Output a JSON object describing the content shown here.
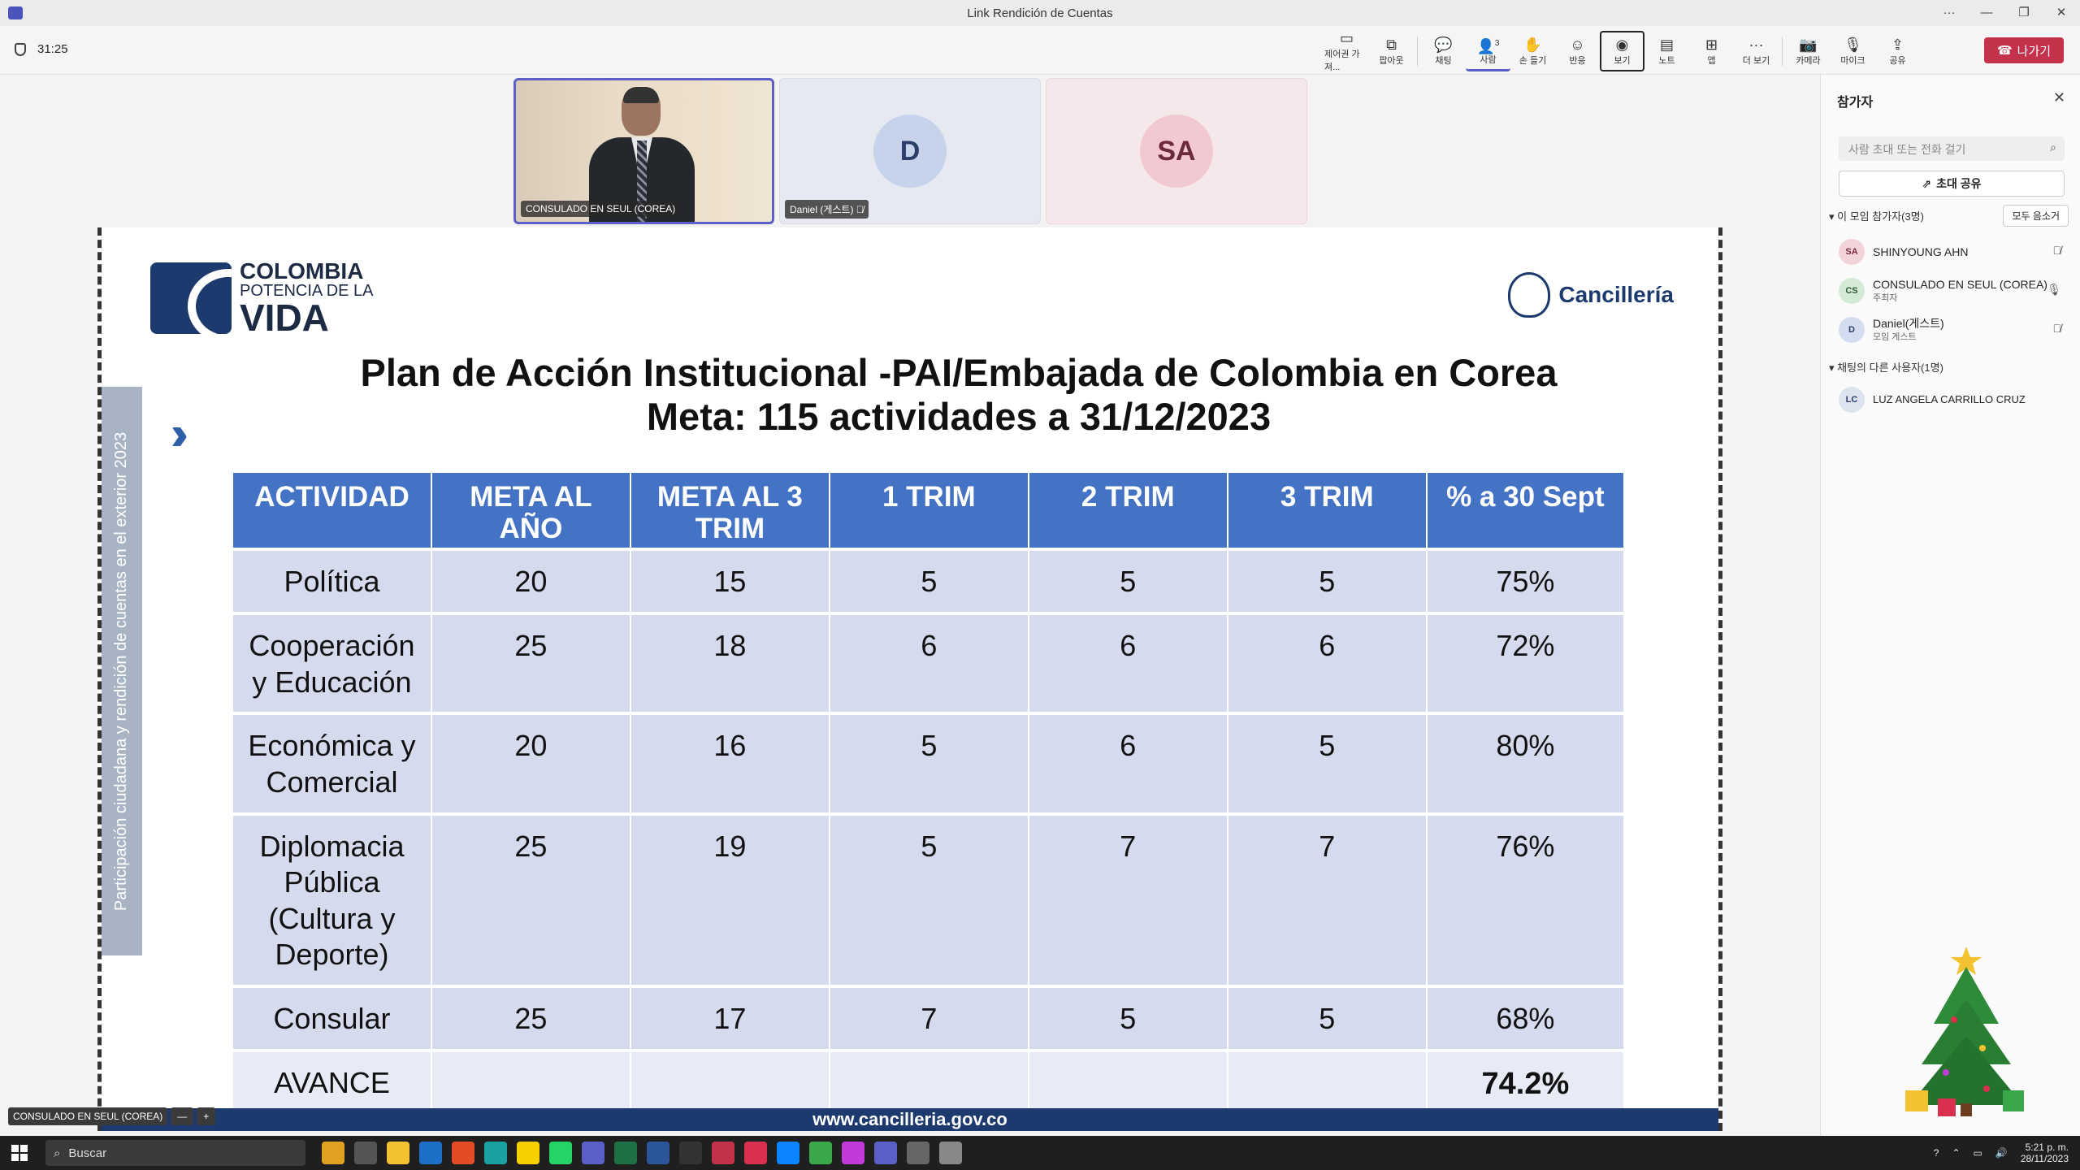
{
  "window": {
    "title": "Link Rendición de Cuentas"
  },
  "meeting": {
    "timer": "31:25",
    "toolbar": [
      {
        "label": "제어권 가져...",
        "icon": "control-icon"
      },
      {
        "label": "팝아웃",
        "icon": "popout-icon"
      },
      {
        "label": "채팅",
        "icon": "chat-icon"
      },
      {
        "label": "사람",
        "icon": "people-icon",
        "count": "3"
      },
      {
        "label": "손 들기",
        "icon": "raise-hand-icon"
      },
      {
        "label": "반응",
        "icon": "reactions-icon"
      },
      {
        "label": "보기",
        "icon": "view-icon"
      },
      {
        "label": "노트",
        "icon": "notes-icon"
      },
      {
        "label": "앱",
        "icon": "apps-icon"
      },
      {
        "label": "더 보기",
        "icon": "more-icon"
      },
      {
        "label": "카메라",
        "icon": "camera-icon"
      },
      {
        "label": "마이크",
        "icon": "mic-icon"
      },
      {
        "label": "공유",
        "icon": "share-icon"
      }
    ],
    "leave_label": "나가기",
    "videos": [
      {
        "name": "CONSULADO EN SEUL (COREA)"
      },
      {
        "name": "Daniel (게스트)",
        "initials": "D"
      },
      {
        "initials": "SA"
      }
    ],
    "presenter_tag": "CONSULADO EN SEUL (COREA)"
  },
  "slide": {
    "logo_left": {
      "line1": "COLOMBIA",
      "line2": "POTENCIA DE LA",
      "line3": "VIDA"
    },
    "logo_right": "Cancillería",
    "side_banner": "Participación ciudadana y rendición de cuentas en el exterior 2023",
    "title_line1": "Plan de Acción Institucional -PAI/Embajada de Colombia en Corea",
    "title_line2": "Meta: 115 actividades a 31/12/2023",
    "table": {
      "headers": [
        "ACTIVIDAD",
        "META AL AÑO",
        "META AL 3 TRIM",
        "1 TRIM",
        "2 TRIM",
        "3 TRIM",
        "% a 30 Sept"
      ],
      "rows": [
        [
          "Política",
          "20",
          "15",
          "5",
          "5",
          "5",
          "75%"
        ],
        [
          "Cooperación y Educación",
          "25",
          "18",
          "6",
          "6",
          "6",
          "72%"
        ],
        [
          "Económica y Comercial",
          "20",
          "16",
          "5",
          "6",
          "5",
          "80%"
        ],
        [
          "Diplomacia Pública (Cultura y Deporte)",
          "25",
          "19",
          "5",
          "7",
          "7",
          "76%"
        ],
        [
          "Consular",
          "25",
          "17",
          "7",
          "5",
          "5",
          "68%"
        ]
      ],
      "total_label": "AVANCE",
      "total_value": "74.2%"
    },
    "footer": "www.cancilleria.gov.co"
  },
  "panel": {
    "title": "참가자",
    "search_placeholder": "사람 초대 또는 전화 걸기",
    "share_invite": "초대 공유",
    "in_meeting": "이 모임 참가자(3명)",
    "mute_all": "모두 음소거",
    "participants": [
      {
        "initials": "SA",
        "name": "SHINYOUNG AHN",
        "role": ""
      },
      {
        "initials": "CS",
        "name": "CONSULADO EN SEUL (COREA)",
        "role": "주최자"
      },
      {
        "initials": "D",
        "name": "Daniel(게스트)",
        "role": "모임 게스트"
      }
    ],
    "others": "채팅의 다른 사용자(1명)",
    "others_list": [
      {
        "initials": "LC",
        "name": "LUZ ANGELA CARRILLO CRUZ"
      }
    ]
  },
  "taskbar": {
    "search": "Buscar",
    "time": "5:21 p. m.",
    "date": "28/11/2023"
  }
}
